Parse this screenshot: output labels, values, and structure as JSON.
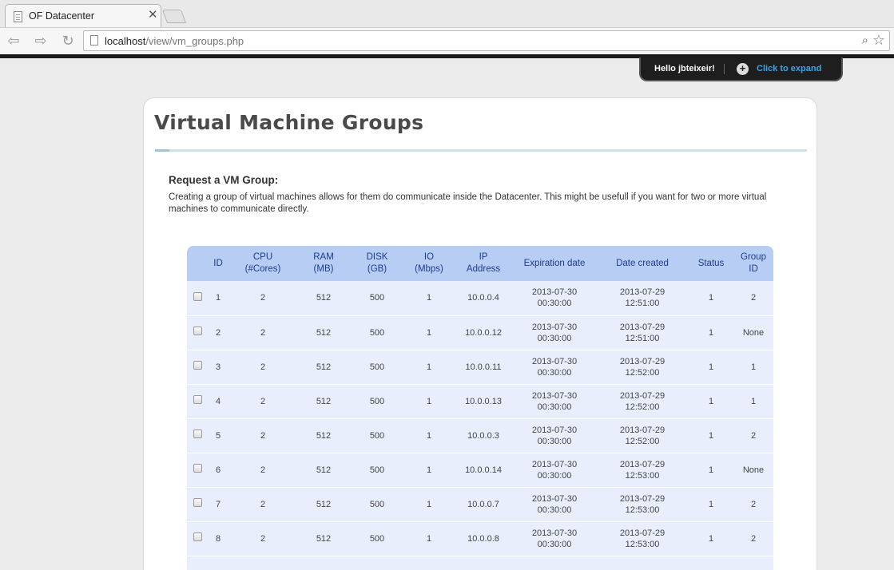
{
  "browser": {
    "tab_title": "OF Datacenter",
    "tab_close": "✕",
    "url_host": "localhost",
    "url_path": "/view/vm_groups.php"
  },
  "user_panel": {
    "greeting": "Hello jbteixeir!",
    "expand_label": "Click to expand"
  },
  "page": {
    "title": "Virtual Machine Groups",
    "request_heading": "Request a VM Group:",
    "request_text": "Creating a group of virtual machines allows for them do communicate inside the Datacenter. This might be usefull if you want for two or more virtual machines to communicate directly."
  },
  "table": {
    "headers": {
      "id": "ID",
      "cpu": "CPU",
      "cpu_sub": "(#Cores)",
      "ram": "RAM",
      "ram_sub": "(MB)",
      "disk": "DISK",
      "disk_sub": "(GB)",
      "io": "IO",
      "io_sub": "(Mbps)",
      "ip": "IP",
      "ip_sub": "Address",
      "expiration": "Expiration date",
      "created": "Date created",
      "status": "Status",
      "group": "Group",
      "group_sub": "ID"
    },
    "rows": [
      {
        "id": "1",
        "cpu": "2",
        "ram": "512",
        "disk": "500",
        "io": "1",
        "ip": "10.0.0.4",
        "exp_date": "2013-07-30",
        "exp_time": "00:30:00",
        "cr_date": "2013-07-29",
        "cr_time": "12:51:00",
        "status": "1",
        "group": "2"
      },
      {
        "id": "2",
        "cpu": "2",
        "ram": "512",
        "disk": "500",
        "io": "1",
        "ip": "10.0.0.12",
        "exp_date": "2013-07-30",
        "exp_time": "00:30:00",
        "cr_date": "2013-07-29",
        "cr_time": "12:51:00",
        "status": "1",
        "group": "None"
      },
      {
        "id": "3",
        "cpu": "2",
        "ram": "512",
        "disk": "500",
        "io": "1",
        "ip": "10.0.0.11",
        "exp_date": "2013-07-30",
        "exp_time": "00:30:00",
        "cr_date": "2013-07-29",
        "cr_time": "12:52:00",
        "status": "1",
        "group": "1"
      },
      {
        "id": "4",
        "cpu": "2",
        "ram": "512",
        "disk": "500",
        "io": "1",
        "ip": "10.0.0.13",
        "exp_date": "2013-07-30",
        "exp_time": "00:30:00",
        "cr_date": "2013-07-29",
        "cr_time": "12:52:00",
        "status": "1",
        "group": "1"
      },
      {
        "id": "5",
        "cpu": "2",
        "ram": "512",
        "disk": "500",
        "io": "1",
        "ip": "10.0.0.3",
        "exp_date": "2013-07-30",
        "exp_time": "00:30:00",
        "cr_date": "2013-07-29",
        "cr_time": "12:52:00",
        "status": "1",
        "group": "2"
      },
      {
        "id": "6",
        "cpu": "2",
        "ram": "512",
        "disk": "500",
        "io": "1",
        "ip": "10.0.0.14",
        "exp_date": "2013-07-30",
        "exp_time": "00:30:00",
        "cr_date": "2013-07-29",
        "cr_time": "12:53:00",
        "status": "1",
        "group": "None"
      },
      {
        "id": "7",
        "cpu": "2",
        "ram": "512",
        "disk": "500",
        "io": "1",
        "ip": "10.0.0.7",
        "exp_date": "2013-07-30",
        "exp_time": "00:30:00",
        "cr_date": "2013-07-29",
        "cr_time": "12:53:00",
        "status": "1",
        "group": "2"
      },
      {
        "id": "8",
        "cpu": "2",
        "ram": "512",
        "disk": "500",
        "io": "1",
        "ip": "10.0.0.8",
        "exp_date": "2013-07-30",
        "exp_time": "00:30:00",
        "cr_date": "2013-07-29",
        "cr_time": "12:53:00",
        "status": "1",
        "group": "2"
      }
    ]
  }
}
